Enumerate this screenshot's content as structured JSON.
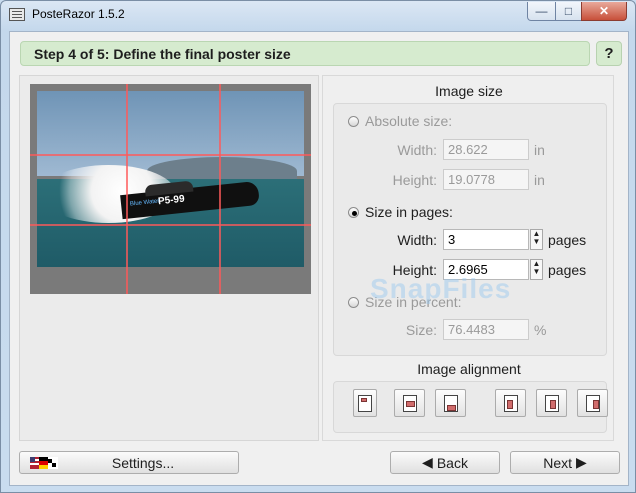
{
  "window": {
    "title": "PosteRazor 1.5.2",
    "controls": {
      "minimize_icon": "minimize-icon",
      "maximize_icon": "maximize-icon",
      "close_icon": "close-icon"
    }
  },
  "step": {
    "title": "Step 4 of 5: Define the final poster size",
    "help": "?"
  },
  "image_size": {
    "group_title": "Image size",
    "absolute": {
      "label": "Absolute size:",
      "width_label": "Width:",
      "width_value": "28.622",
      "width_unit": "in",
      "height_label": "Height:",
      "height_value": "19.0778",
      "height_unit": "in"
    },
    "pages": {
      "label": "Size in pages:",
      "width_label": "Width:",
      "width_value": "3",
      "width_unit": "pages",
      "height_label": "Height:",
      "height_value": "2.6965",
      "height_unit": "pages"
    },
    "percent": {
      "label": "Size in percent:",
      "size_label": "Size:",
      "size_value": "76.4483",
      "size_unit": "%"
    }
  },
  "alignment": {
    "group_title": "Image alignment"
  },
  "buttons": {
    "settings": "Settings...",
    "back": "Back",
    "next": "Next"
  },
  "preview": {
    "boat_label": "P5-99",
    "boat_name": "Blue Water"
  },
  "watermark": "SnapFiles",
  "colors": {
    "step_bg": "#d6ebcf",
    "grid": "#ff6464"
  }
}
